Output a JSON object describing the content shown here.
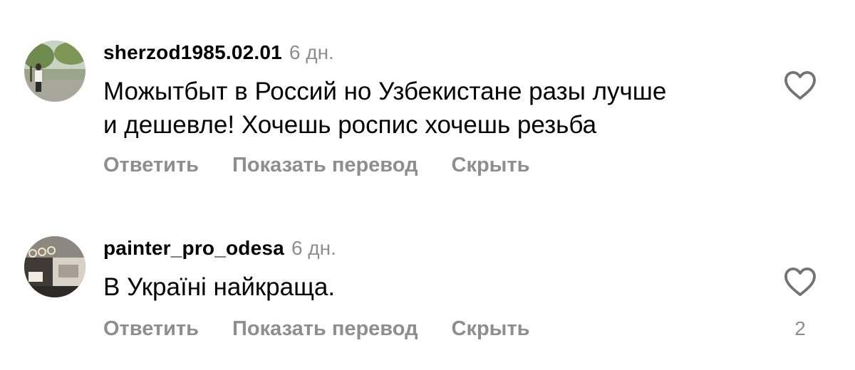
{
  "comments": [
    {
      "username": "sherzod1985.02.01",
      "time": "6 дн.",
      "text_lines": [
        "Можытбыт в Россий но Узбекистане разы лучше",
        "и дешевле! Хочешь роспис хочешь резьба"
      ],
      "actions": {
        "reply": "Ответить",
        "translate": "Показать перевод",
        "hide": "Скрыть"
      },
      "like_count": ""
    },
    {
      "username": "painter_pro_odesa",
      "time": "6 дн.",
      "text_lines": [
        "В Україні найкраща."
      ],
      "actions": {
        "reply": "Ответить",
        "translate": "Показать перевод",
        "hide": "Скрыть"
      },
      "like_count": "2"
    }
  ],
  "icons": {
    "like": "heart-outline-icon"
  },
  "colors": {
    "text": "#000000",
    "secondary": "#8e8e8e",
    "background": "#ffffff"
  }
}
